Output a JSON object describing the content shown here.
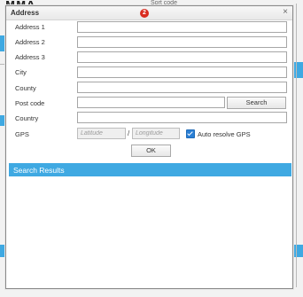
{
  "background": {
    "heading_fragment": "...",
    "sort_fragment": "Sort code"
  },
  "dialog": {
    "title": "Address",
    "badge": "2",
    "close_glyph": "×",
    "labels": {
      "address1": "Address 1",
      "address2": "Address 2",
      "address3": "Address 3",
      "city": "City",
      "county": "County",
      "postcode": "Post code",
      "country": "Country",
      "gps": "GPS"
    },
    "values": {
      "address1": "",
      "address2": "",
      "address3": "",
      "city": "",
      "county": "",
      "postcode": "",
      "country": ""
    },
    "search_button": "Search",
    "gps": {
      "latitude_placeholder": "Latitude",
      "longitude_placeholder": "Longitude",
      "separator": "/",
      "auto_resolve_label": "Auto resolve GPS",
      "auto_resolve_checked": true
    },
    "ok_button": "OK",
    "results": {
      "header": "Search Results",
      "header_color": "#3fa9e2",
      "items": []
    }
  }
}
